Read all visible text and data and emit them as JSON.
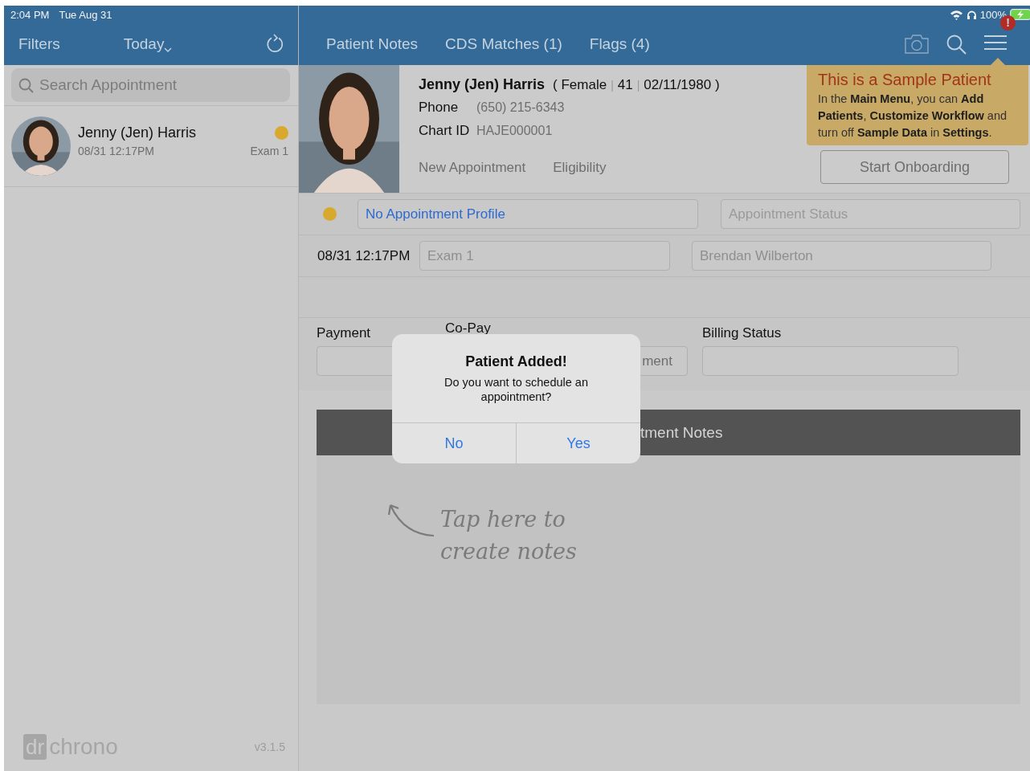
{
  "status_bar": {
    "time": "2:04 PM",
    "date": "Tue Aug 31",
    "battery": "100%"
  },
  "left_nav": {
    "filters": "Filters",
    "today": "Today"
  },
  "search": {
    "placeholder": "Search Appointment"
  },
  "appointments": [
    {
      "name": "Jenny (Jen) Harris",
      "time": "08/31 12:17PM",
      "room": "Exam 1",
      "color": "#d9a92f"
    }
  ],
  "tabs": [
    {
      "label": "Patient Notes"
    },
    {
      "label": "CDS Matches (1)"
    },
    {
      "label": "Flags (4)"
    }
  ],
  "menu_badge": "!",
  "patient": {
    "name": "Jenny (Jen) Harris",
    "open_paren": "(",
    "close_paren": ")",
    "separators": [
      "|",
      "|"
    ],
    "sex": "Female",
    "age": "41",
    "dob": "02/11/1980",
    "phone_label": "Phone",
    "phone": "(650) 215-6343",
    "chart_label": "Chart ID",
    "chart_id": "HAJE000001",
    "actions": [
      "New Appointment",
      "Eligibility"
    ]
  },
  "tooltip": {
    "title": "This is a Sample Patient",
    "body": "In the **Main Menu**, you can **Add Patients**, **Customize Workflow** and turn off **Sample Data** in **Settings**."
  },
  "onboarding_button": "Start Onboarding",
  "appointment": {
    "color": "#d9a92f",
    "profile": "No Appointment Profile",
    "status_placeholder": "Appointment Status",
    "datetime": "08/31 12:17PM",
    "room": "Exam 1",
    "provider": "Brendan Wilberton"
  },
  "billing": {
    "payment_label": "Payment",
    "copay_label": "Co-Pay",
    "copay_field": "ment",
    "billing_status_label": "Billing Status"
  },
  "notes": {
    "header": "tment Notes",
    "hint_lines": [
      "Tap here to",
      "create notes"
    ]
  },
  "dialog": {
    "title": "Patient Added!",
    "message": "Do you want to schedule an appointment?",
    "buttons": [
      "No",
      "Yes"
    ]
  },
  "footer": {
    "logo_mark": "dr",
    "logo_text": "chrono",
    "version": "v3.1.5"
  }
}
